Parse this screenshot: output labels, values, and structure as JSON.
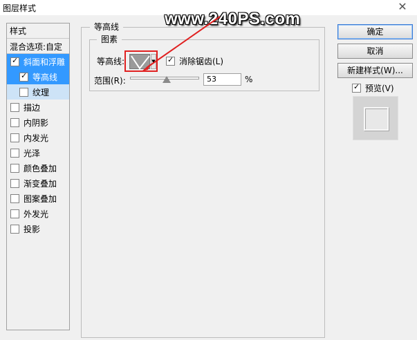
{
  "window": {
    "title": "图层样式",
    "close_glyph": "✕"
  },
  "watermark": "www.240PS.com",
  "left_panel": {
    "header": "样式",
    "blend_options": "混合选项:自定",
    "items": [
      {
        "label": "斜面和浮雕",
        "checked": true,
        "state": "selected"
      },
      {
        "label": "等高线",
        "checked": true,
        "state": "selected-sub"
      },
      {
        "label": "纹理",
        "checked": false,
        "state": "sub"
      },
      {
        "label": "描边",
        "checked": false
      },
      {
        "label": "内阴影",
        "checked": false
      },
      {
        "label": "内发光",
        "checked": false
      },
      {
        "label": "光泽",
        "checked": false
      },
      {
        "label": "颜色叠加",
        "checked": false
      },
      {
        "label": "渐变叠加",
        "checked": false
      },
      {
        "label": "图案叠加",
        "checked": false
      },
      {
        "label": "外发光",
        "checked": false
      },
      {
        "label": "投影",
        "checked": false
      }
    ]
  },
  "main": {
    "group_title": "等高线",
    "subgroup_title": "图素",
    "contour_label": "等高线:",
    "antialias_label": "消除锯齿(L)",
    "antialias_checked": true,
    "range_label": "范围(R):",
    "range_value": "53",
    "range_unit": "%",
    "range_fraction": 0.53
  },
  "buttons": {
    "ok": "确定",
    "cancel": "取消",
    "new_style": "新建样式(W)...",
    "preview_label": "预览(V)",
    "preview_checked": true
  },
  "colors": {
    "selected_bg": "#3399ff",
    "highlight_border": "#e02020",
    "arrow": "#e02020"
  }
}
